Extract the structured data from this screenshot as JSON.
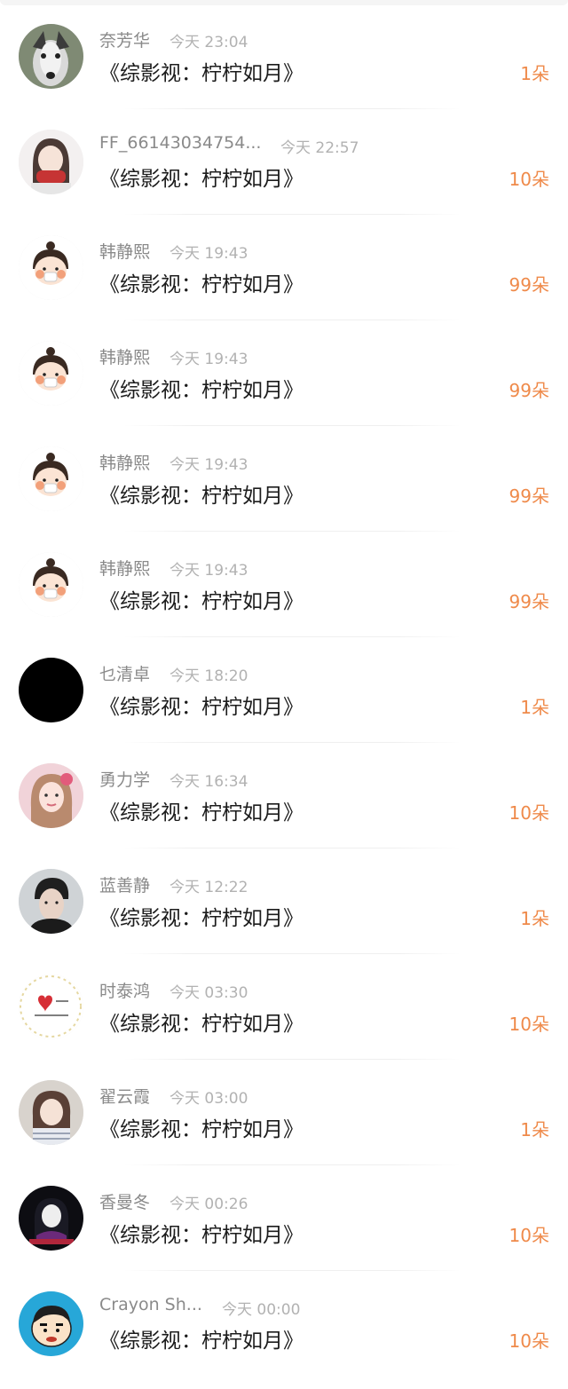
{
  "list": {
    "items": [
      {
        "name": "奈芳华",
        "time": "今天 23:04",
        "title": "《综影视：柠柠如月》",
        "amount": "1朵",
        "avatar": "dog-avatar-icon"
      },
      {
        "name": "FF_66143034754...",
        "time": "今天 22:57",
        "title": "《综影视：柠柠如月》",
        "amount": "10朵",
        "avatar": "girl-scarf-avatar-icon"
      },
      {
        "name": "韩静熙",
        "time": "今天 19:43",
        "title": "《综影视：柠柠如月》",
        "amount": "99朵",
        "avatar": "cartoon-girl-avatar-icon"
      },
      {
        "name": "韩静熙",
        "time": "今天 19:43",
        "title": "《综影视：柠柠如月》",
        "amount": "99朵",
        "avatar": "cartoon-girl-avatar-icon"
      },
      {
        "name": "韩静熙",
        "time": "今天 19:43",
        "title": "《综影视：柠柠如月》",
        "amount": "99朵",
        "avatar": "cartoon-girl-avatar-icon"
      },
      {
        "name": "韩静熙",
        "time": "今天 19:43",
        "title": "《综影视：柠柠如月》",
        "amount": "99朵",
        "avatar": "cartoon-girl-avatar-icon"
      },
      {
        "name": "乜清卓",
        "time": "今天 18:20",
        "title": "《综影视：柠柠如月》",
        "amount": "1朵",
        "avatar": "black-avatar-icon"
      },
      {
        "name": "勇力学",
        "time": "今天 16:34",
        "title": "《综影视：柠柠如月》",
        "amount": "10朵",
        "avatar": "woman-photo-avatar-icon"
      },
      {
        "name": "蓝善静",
        "time": "今天 12:22",
        "title": "《综影视：柠柠如月》",
        "amount": "1朵",
        "avatar": "man-photo-avatar-icon"
      },
      {
        "name": "时泰鸿",
        "time": "今天 03:30",
        "title": "《综影视：柠柠如月》",
        "amount": "10朵",
        "avatar": "heart-avatar-icon"
      },
      {
        "name": "翟云霞",
        "time": "今天 03:00",
        "title": "《综影视：柠柠如月》",
        "amount": "1朵",
        "avatar": "child-photo-avatar-icon"
      },
      {
        "name": "香曼冬",
        "time": "今天 00:26",
        "title": "《综影视：柠柠如月》",
        "amount": "10朵",
        "avatar": "dark-art-avatar-icon"
      },
      {
        "name": "Crayon Sh...",
        "time": "今天 00:00",
        "title": "《综影视：柠柠如月》",
        "amount": "10朵",
        "avatar": "crayon-shin-avatar-icon"
      }
    ]
  },
  "colors": {
    "accent": "#ef8a4a",
    "name": "#8a8a8a",
    "time": "#b2b2b2",
    "title": "#1c1c1c"
  }
}
